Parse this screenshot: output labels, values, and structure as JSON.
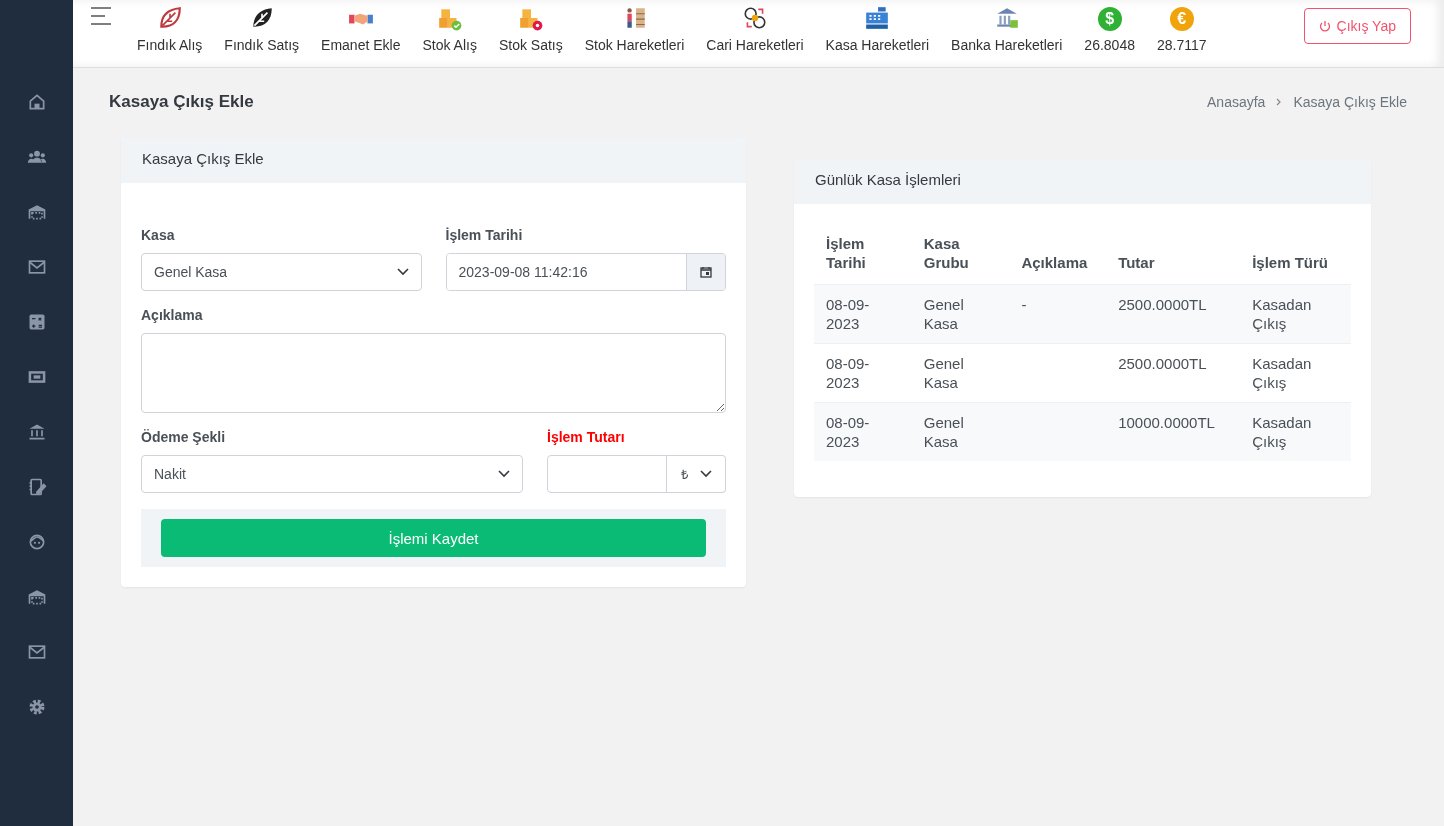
{
  "toolbar": {
    "items": [
      {
        "label": "Fındık Alış"
      },
      {
        "label": "Fındık Satış"
      },
      {
        "label": "Emanet Ekle"
      },
      {
        "label": "Stok Alış"
      },
      {
        "label": "Stok Satış"
      },
      {
        "label": "Stok Hareketleri"
      },
      {
        "label": "Cari Hareketleri"
      },
      {
        "label": "Kasa Hareketleri"
      },
      {
        "label": "Banka Hareketleri"
      }
    ],
    "rates": [
      {
        "symbol": "$",
        "value": "26.8048",
        "color": "#2eb135"
      },
      {
        "symbol": "€",
        "value": "28.7117",
        "color": "#f0a30a"
      }
    ],
    "logout": "Çıkış Yap"
  },
  "page": {
    "title": "Kasaya Çıkış Ekle",
    "breadcrumb": [
      "Anasayfa",
      "Kasaya Çıkış Ekle"
    ]
  },
  "form": {
    "title": "Kasaya Çıkış Ekle",
    "kasa": {
      "label": "Kasa",
      "value": "Genel Kasa"
    },
    "date": {
      "label": "İşlem Tarihi",
      "value": "2023-09-08 11:42:16"
    },
    "description": {
      "label": "Açıklama"
    },
    "payment": {
      "label": "Ödeme Şekli",
      "value": "Nakit"
    },
    "amount": {
      "label": "İşlem Tutarı",
      "currency": "₺"
    },
    "submit": "İşlemi Kaydet"
  },
  "table": {
    "title": "Günlük Kasa İşlemleri",
    "columns": [
      "İşlem Tarihi",
      "Kasa Grubu",
      "Açıklama",
      "Tutar",
      "İşlem Türü"
    ],
    "rows": [
      [
        "08-09-2023",
        "Genel Kasa",
        "-",
        "2500.0000TL",
        "Kasadan Çıkış"
      ],
      [
        "08-09-2023",
        "Genel Kasa",
        "",
        "2500.0000TL",
        "Kasadan Çıkış"
      ],
      [
        "08-09-2023",
        "Genel Kasa",
        "",
        "10000.0000TL",
        "Kasadan Çıkış"
      ]
    ]
  }
}
